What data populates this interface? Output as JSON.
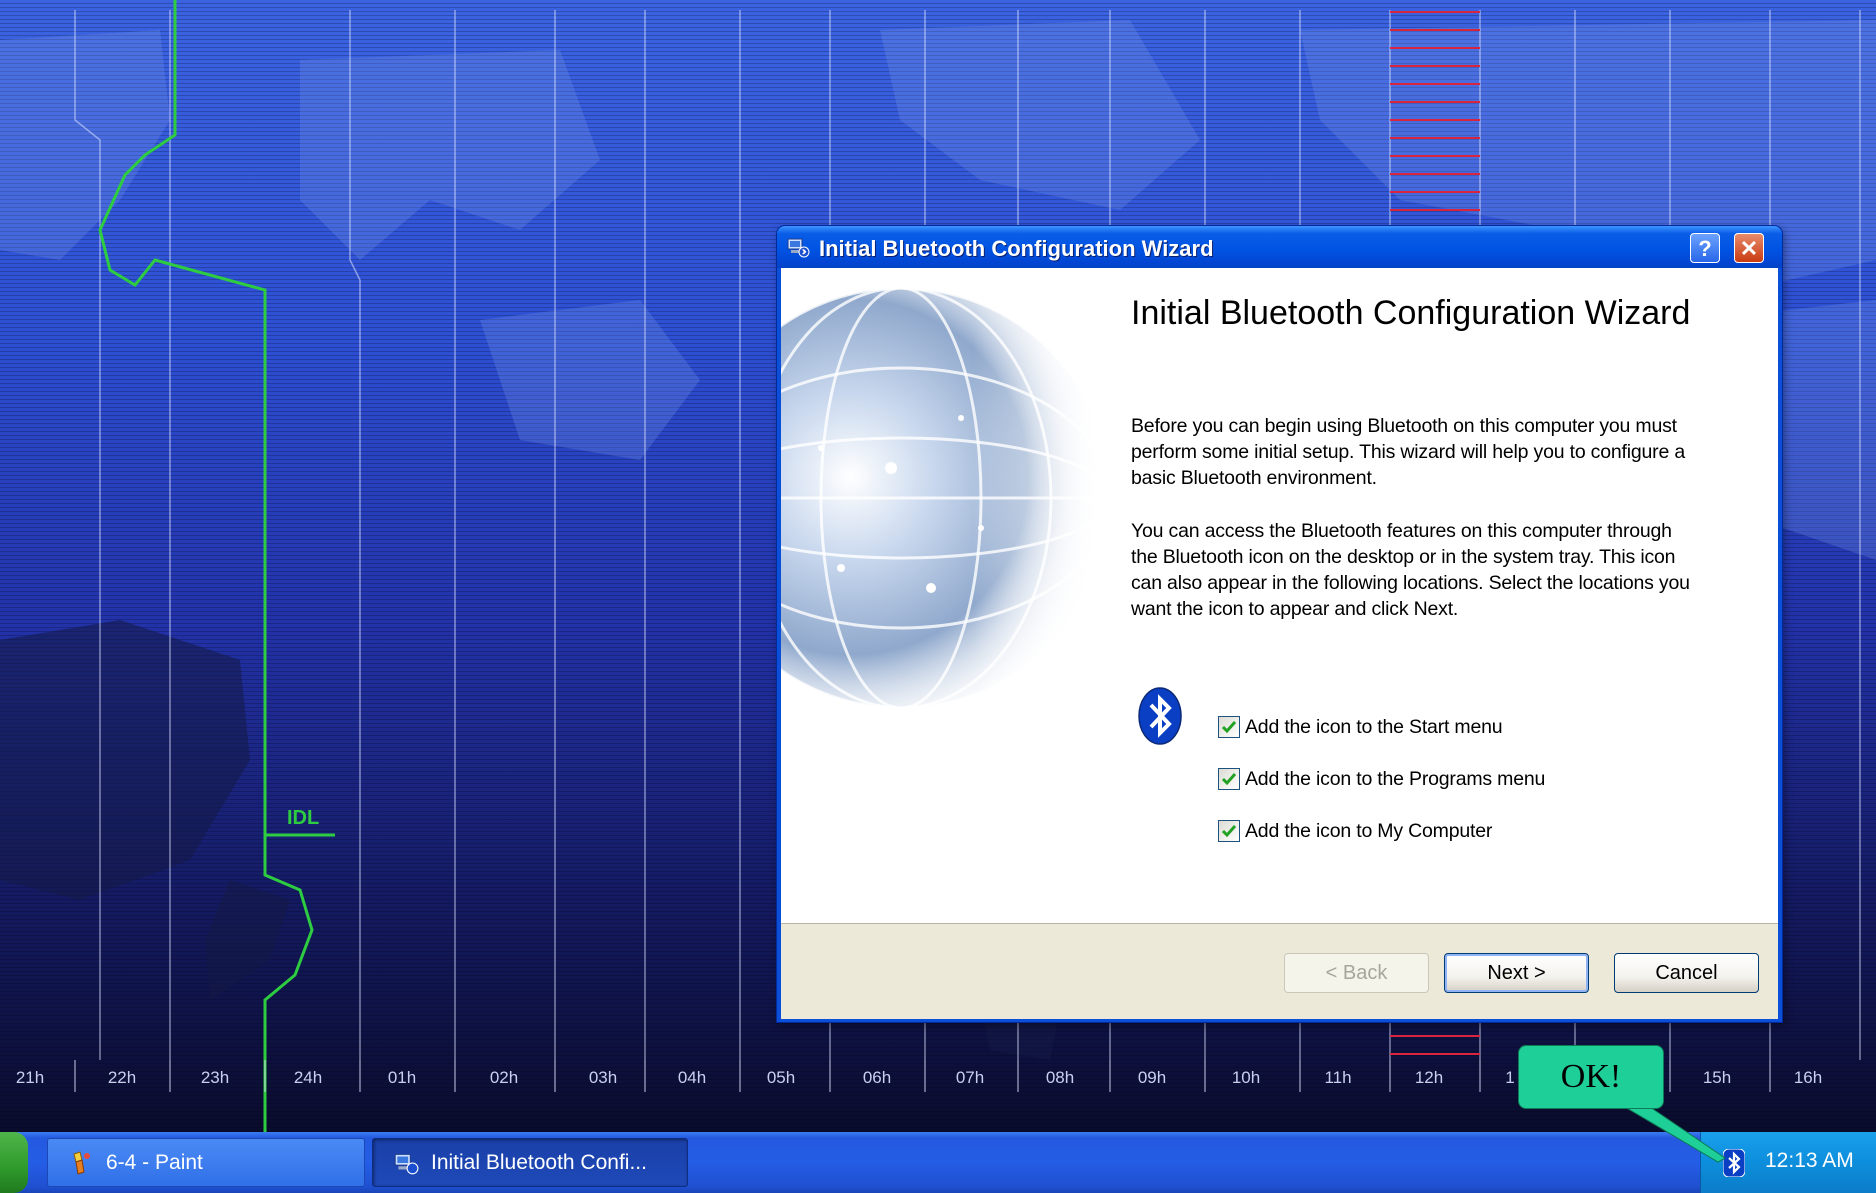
{
  "desktop": {
    "time_zones": [
      "21h",
      "22h",
      "23h",
      "24h",
      "01h",
      "02h",
      "03h",
      "04h",
      "05h",
      "06h",
      "07h",
      "08h",
      "09h",
      "10h",
      "11h",
      "12h",
      "1",
      "15h",
      "16h"
    ],
    "idl_label": "IDL"
  },
  "wizard": {
    "title": "Initial Bluetooth Configuration Wizard",
    "heading": "Initial Bluetooth Configuration Wizard",
    "paragraph1": "Before you can begin using Bluetooth on this computer you must perform some initial setup. This wizard will help you to configure a basic Bluetooth environment.",
    "paragraph2": "You can access the Bluetooth features on this computer through the Bluetooth icon on the desktop or in the system tray. This icon can also appear in the following locations. Select the locations you want the icon to appear and click Next.",
    "checkboxes": [
      {
        "label": "Add the icon to the Start menu",
        "checked": true
      },
      {
        "label": "Add the icon to the Programs menu",
        "checked": true
      },
      {
        "label": "Add the icon to My Computer",
        "checked": true
      }
    ],
    "buttons": {
      "back": "< Back",
      "next": "Next >",
      "cancel": "Cancel"
    },
    "title_buttons": {
      "help": "?",
      "close": "✕"
    }
  },
  "taskbar": {
    "tasks": [
      {
        "label": "6-4 - Paint",
        "icon": "paint-icon"
      },
      {
        "label": "Initial Bluetooth Confi...",
        "icon": "bluetooth-wizard-icon"
      }
    ],
    "clock": "12:13 AM",
    "tray_icon": "bluetooth-icon"
  },
  "callout": {
    "text": "OK!"
  },
  "colors": {
    "titlebar": "#0054e3",
    "callout": "#1ecf97",
    "tray": "#0d8edc",
    "idl_line": "#2ecc40"
  }
}
